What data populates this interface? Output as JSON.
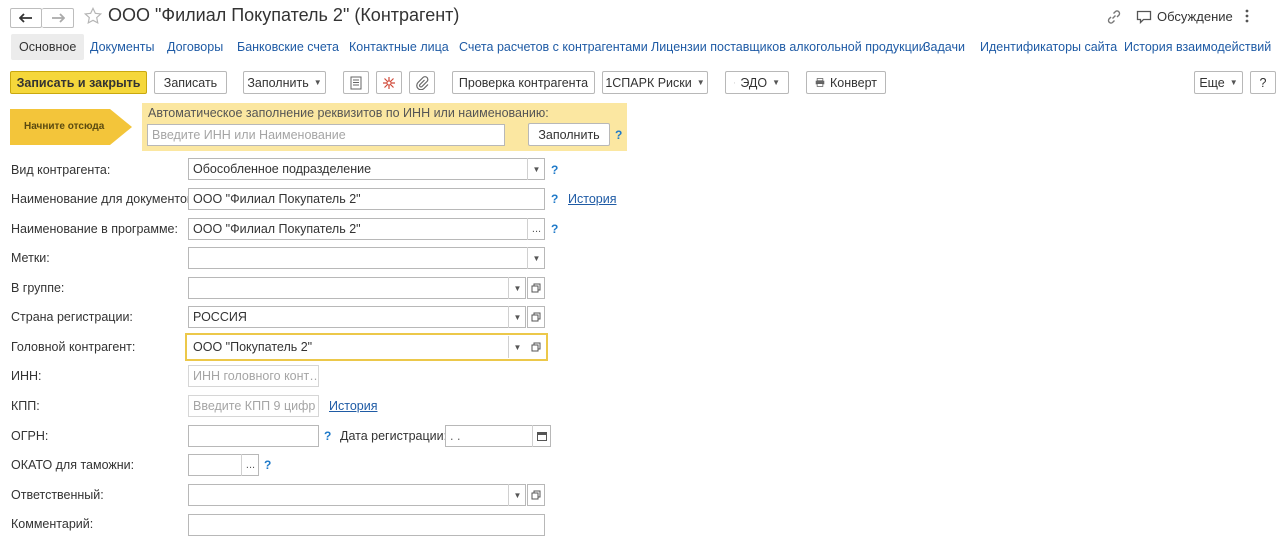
{
  "window": {
    "title": "ООО \"Филиал Покупатель 2\" (Контрагент)",
    "discussion_label": "Обсуждение"
  },
  "tabs": [
    {
      "label": "Основное",
      "active": true
    },
    {
      "label": "Документы"
    },
    {
      "label": "Договоры"
    },
    {
      "label": "Банковские счета"
    },
    {
      "label": "Контактные лица"
    },
    {
      "label": "Счета расчетов с контрагентами"
    },
    {
      "label": "Лицензии поставщиков алкогольной продукции"
    },
    {
      "label": "Задачи"
    },
    {
      "label": "Идентификаторы сайта"
    },
    {
      "label": "История взаимодействий"
    }
  ],
  "toolbar": {
    "save_close": "Записать и закрыть",
    "save": "Записать",
    "fill": "Заполнить",
    "check": "Проверка контрагента",
    "spark": "1СПАРК Риски",
    "edo": "ЭДО",
    "envelope": "Конверт",
    "more": "Еще",
    "help": "?"
  },
  "autofill": {
    "arrow_label": "Начните отсюда",
    "hint": "Автоматическое заполнение реквизитов по ИНН или наименованию:",
    "placeholder": "Введите ИНН или Наименование",
    "button": "Заполнить",
    "help": "?"
  },
  "form": {
    "kind_label": "Вид контрагента:",
    "kind_value": "Обособленное подразделение",
    "docname_label": "Наименование для документов:",
    "docname_value": "ООО \"Филиал Покупатель 2\"",
    "history_link": "История",
    "progname_label": "Наименование в программе:",
    "progname_value": "ООО \"Филиал Покупатель 2\"",
    "tags_label": "Метки:",
    "group_label": "В группе:",
    "country_label": "Страна регистрации:",
    "country_value": "РОССИЯ",
    "parent_label": "Головной контрагент:",
    "parent_value": "ООО \"Покупатель 2\"",
    "inn_label": "ИНН:",
    "inn_placeholder": "ИНН головного конт…",
    "kpp_label": "КПП:",
    "kpp_placeholder": "Введите КПП 9 цифр",
    "ogrn_label": "ОГРН:",
    "regdate_label": "Дата регистрации:",
    "regdate_value": " .  .",
    "okato_label": "ОКАТО для таможни:",
    "responsible_label": "Ответственный:",
    "comment_label": "Комментарий:",
    "help": "?",
    "ellipsis": "..."
  }
}
